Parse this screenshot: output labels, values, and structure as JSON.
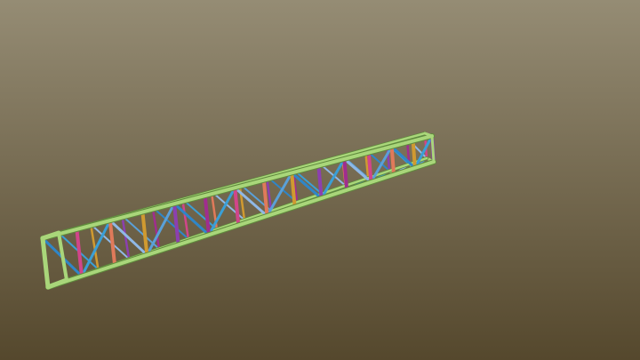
{
  "scene": {
    "background_top": "#958c74",
    "background_bottom": "#55482d",
    "truss": {
      "chord_color": "#a9d67a",
      "chord_edge": "#5f8a3c",
      "diagonal_colors": [
        "#2f86c8",
        "#3a9fd6",
        "#8fb8e6",
        "#5aa0d8"
      ],
      "post_colors": [
        "#a02d8f",
        "#d1458a",
        "#e07a5a",
        "#d09a30",
        "#8c3fb0"
      ],
      "bay_count": 14
    }
  }
}
